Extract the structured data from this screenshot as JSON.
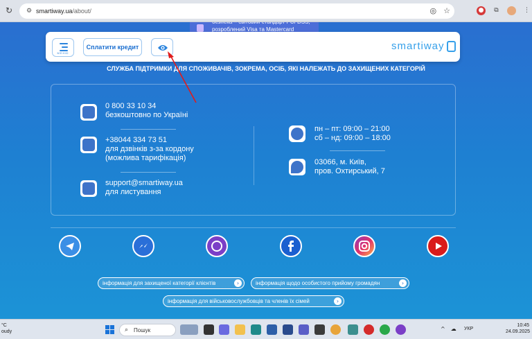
{
  "browser": {
    "reload_icon": "↻",
    "url_host": "smartiway.ua",
    "url_path": "/about/",
    "omnibox_icons": [
      "eye-slash-icon",
      "star-icon"
    ],
    "extensions": [
      "extension-badge-icon",
      "puzzle-icon",
      "profile-avatar",
      "more-menu-icon"
    ]
  },
  "top_notice": {
    "text": "безпека – світовий стандарт PCI DSS,\nрозроблений Visa та Mastercard"
  },
  "header": {
    "menu_label": "МЕНЮ",
    "pay_button": "Сплатити кредит",
    "logo_text": "smartiway"
  },
  "section_title": "СЛУЖБА ПІДТРИМКИ ДЛЯ СПОЖИВАЧІВ, ЗОКРЕМА, ОСІБ, ЯКІ НАЛЕЖАТЬ ДО ЗАХИЩЕНИХ КАТЕГОРІЙ",
  "contacts": {
    "phone_free": "0 800 33 10 34\nбезкоштовно по Україні",
    "phone_intl": "+38044 334 73 51\nдля дзвінків з-за кордону\n(можлива тарифікація)",
    "email": "support@smartiway.ua\nдля листування",
    "hours": "пн – пт: 09:00 – 21:00\nсб – нд: 09:00 – 18:00",
    "address": "03066, м. Київ,\nпров. Охтирський, 7"
  },
  "socials": [
    "telegram-icon",
    "messenger-icon",
    "viber-icon",
    "facebook-icon",
    "instagram-icon",
    "youtube-icon"
  ],
  "links": {
    "protected": "інформація для захищеної категорії клієнтів",
    "reception": "інформація щодо особистого прийому громадян",
    "military": "інформація для військовослужбовців та членів їх сімей"
  },
  "taskbar": {
    "weather": "°C\noudy",
    "search_label": "Пошук",
    "lang": "УКР",
    "time": "10:45",
    "date": "24.09.2025"
  }
}
